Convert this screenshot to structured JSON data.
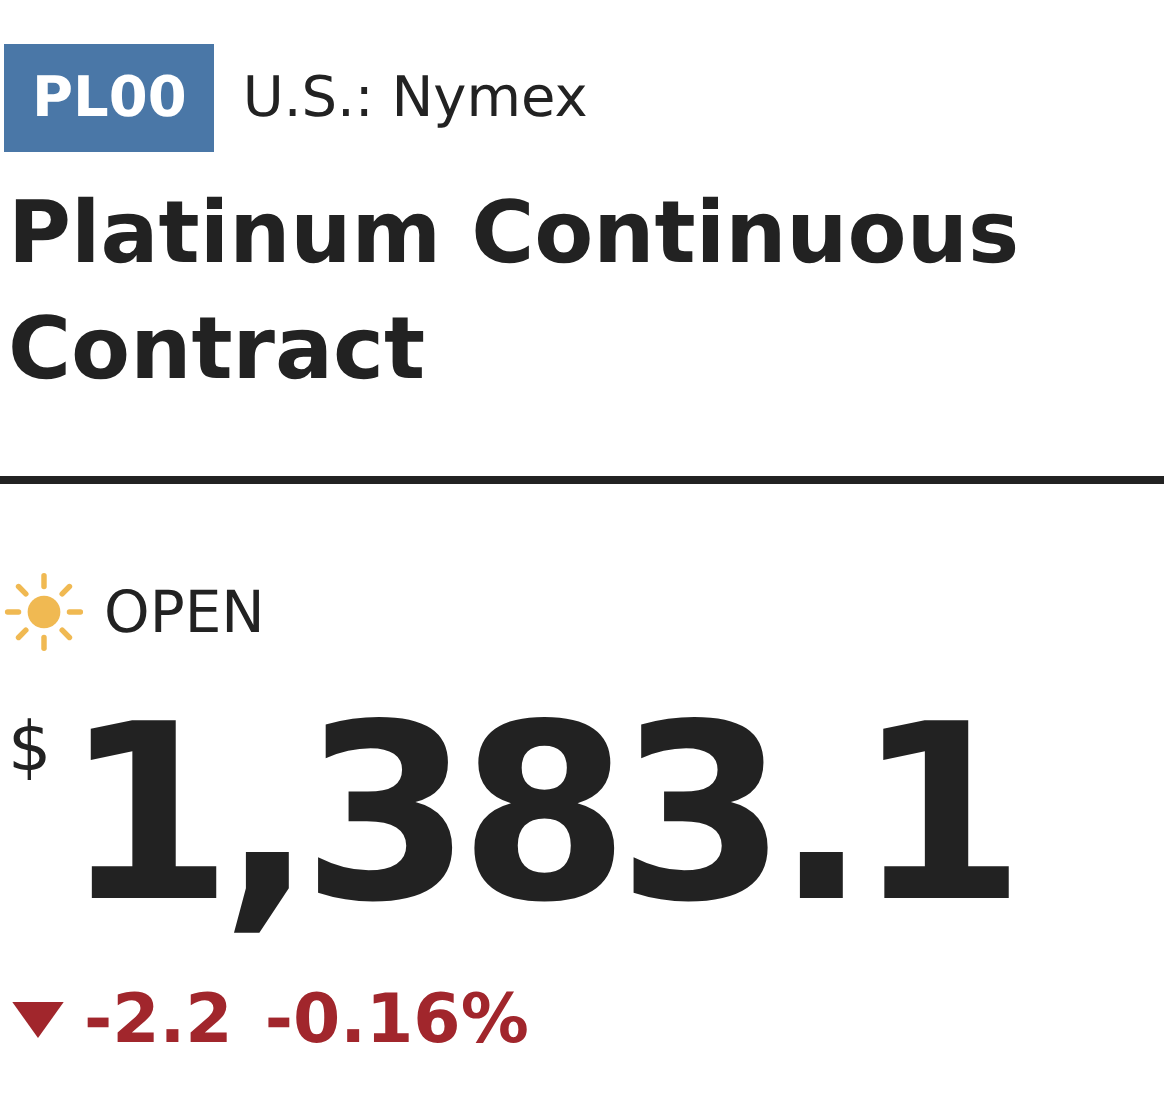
{
  "ticker": "PL00",
  "exchange": "U.S.: Nymex",
  "title": "Platinum Continuous Contract",
  "market_status": {
    "kind": "open",
    "label": "OPEN"
  },
  "price": {
    "currency": "$",
    "value": "1,383.1"
  },
  "change": {
    "falling": true,
    "amount": "-2.2",
    "percent": "-0.16%"
  }
}
